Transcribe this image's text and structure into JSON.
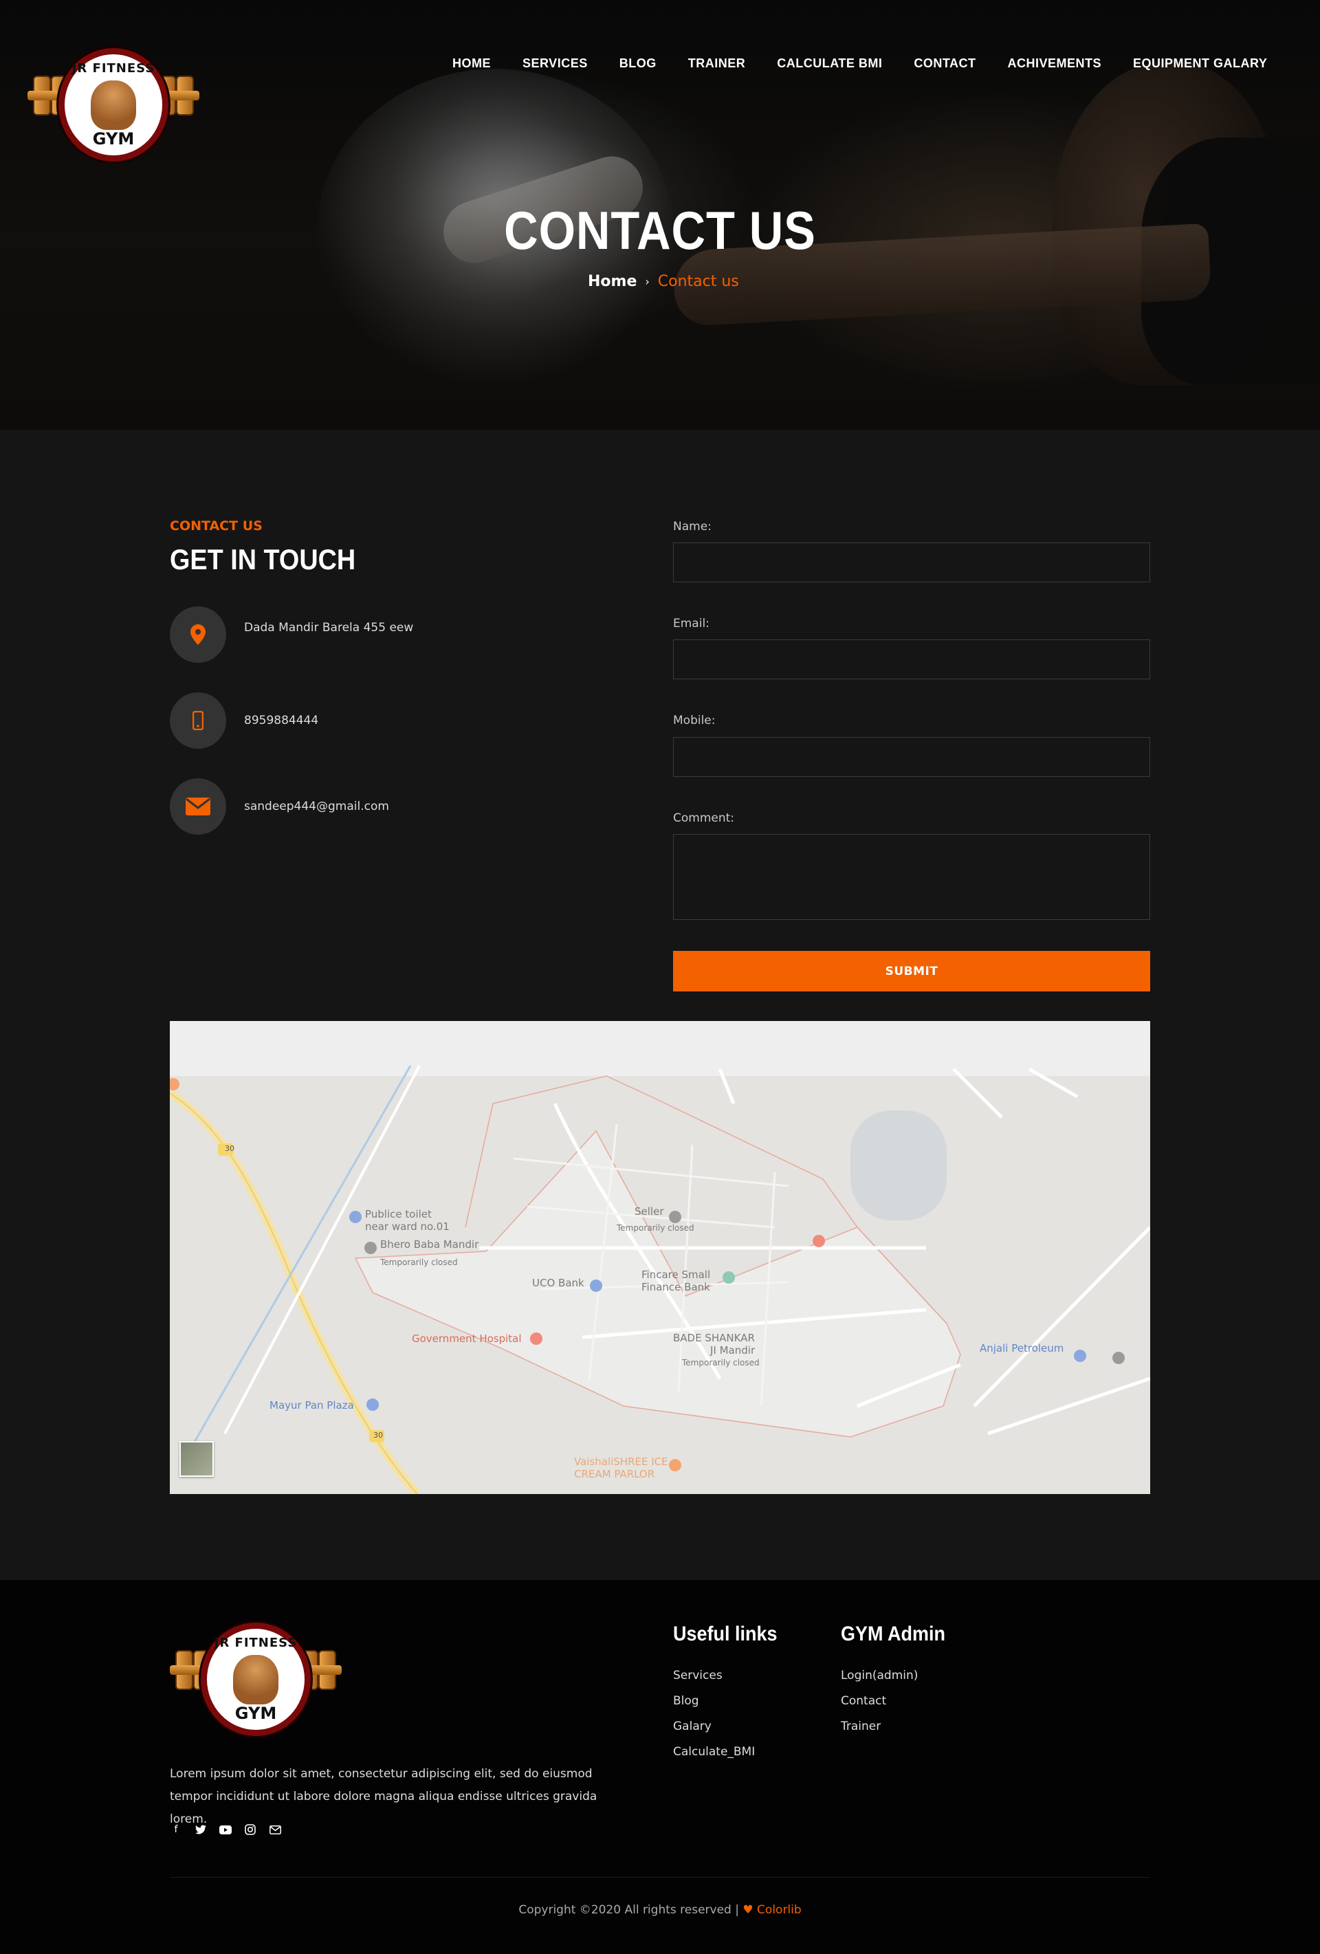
{
  "brand": {
    "logo_top_text": "JR FITNESS",
    "logo_bottom_text": "GYM"
  },
  "nav": {
    "items": [
      "HOME",
      "SERVICES",
      "BLOG",
      "TRAINER",
      "CALCULATE BMI",
      "CONTACT",
      "ACHIVEMENTS",
      "EQUIPMENT GALARY"
    ]
  },
  "hero": {
    "title": "CONTACT US",
    "breadcrumb_home": "Home",
    "breadcrumb_current": "Contact us"
  },
  "contact": {
    "eyebrow": "CONTACT US",
    "title": "GET IN TOUCH",
    "address": "Dada Mandir Barela 455 eew",
    "phone": "8959884444",
    "email": "sandeep444@gmail.com"
  },
  "form": {
    "name_label": "Name:",
    "email_label": "Email:",
    "mobile_label": "Mobile:",
    "comment_label": "Comment:",
    "name_value": "",
    "email_value": "",
    "mobile_value": "",
    "comment_value": "",
    "submit_label": "SUBMIT"
  },
  "map": {
    "labels": {
      "toilet": "Publice toilet",
      "toilet_sub": "near ward no.01",
      "bhero": "Bhero Baba Mandir",
      "bhero_sub": "Temporarily closed",
      "seller": "Seller",
      "seller_sub": "Temporarily closed",
      "uco": "UCO Bank",
      "fincare": "Fincare Small",
      "fincare_sub": "Finance Bank",
      "hospital": "Government Hospital",
      "bade": "BADE SHANKAR",
      "bade_sub": "JI Mandir",
      "bade_sub2": "Temporarily closed",
      "mayur": "Mayur Pan Plaza",
      "anjali": "Anjali Petroleum",
      "vaishali": "VaishaliSHREE ICE",
      "vaishali_sub": "CREAM PARLOR",
      "route_a": "30",
      "route_b": "30"
    }
  },
  "footer": {
    "about": "Lorem ipsum dolor sit amet, consectetur adipiscing elit, sed do eiusmod tempor incididunt ut labore dolore magna aliqua endisse ultrices gravida lorem.",
    "useful_title": "Useful links",
    "useful_links": [
      "Services",
      "Blog",
      "Galary",
      "Calculate_BMI"
    ],
    "admin_title": "GYM Admin",
    "admin_links": [
      "Login(admin)",
      "Contact",
      "Trainer"
    ],
    "copyright": "Copyright ©2020 All rights reserved |",
    "credit": "Colorlib"
  },
  "colors": {
    "accent": "#f36100",
    "background": "#151515",
    "footer_bg": "#030303",
    "map_bg": "#e5e3df"
  },
  "icons": {
    "address": "map-pin-icon",
    "phone": "mobile-phone-icon",
    "email": "envelope-icon",
    "social": [
      "facebook-icon",
      "twitter-icon",
      "youtube-icon",
      "instagram-icon",
      "mail-icon"
    ]
  }
}
